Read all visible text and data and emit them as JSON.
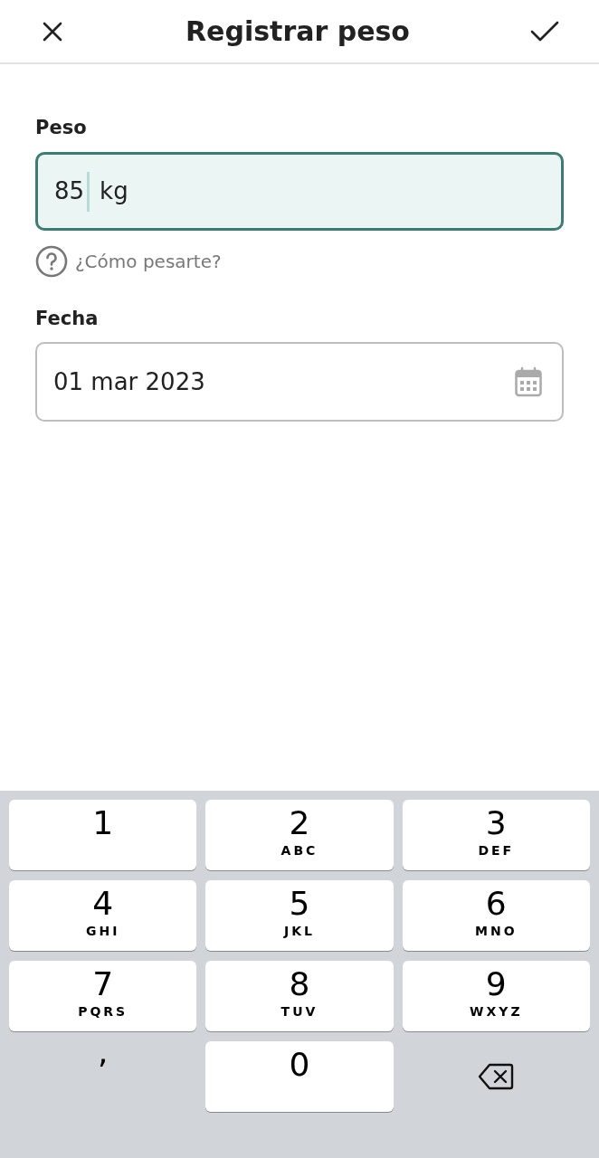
{
  "header": {
    "title": "Registrar peso"
  },
  "weight": {
    "label": "Peso",
    "value": "85",
    "unit": "kg",
    "focused": true
  },
  "help_link": "¿Cómo pesarte?",
  "date": {
    "label": "Fecha",
    "value": "01 mar 2023"
  },
  "keypad": [
    {
      "kind": "digit",
      "label": "1"
    },
    {
      "kind": "digit",
      "label": "2",
      "letters": "ABC"
    },
    {
      "kind": "digit",
      "label": "3",
      "letters": "DEF"
    },
    {
      "kind": "digit",
      "label": "4",
      "letters": "GHI"
    },
    {
      "kind": "digit",
      "label": "5",
      "letters": "JKL"
    },
    {
      "kind": "digit",
      "label": "6",
      "letters": "MNO"
    },
    {
      "kind": "digit",
      "label": "7",
      "letters": "PQRS"
    },
    {
      "kind": "digit",
      "label": "8",
      "letters": "TUV"
    },
    {
      "kind": "digit",
      "label": "9",
      "letters": "WXYZ"
    },
    {
      "kind": "symbol",
      "label": ","
    },
    {
      "kind": "digit",
      "label": "0"
    },
    {
      "kind": "backspace"
    }
  ]
}
